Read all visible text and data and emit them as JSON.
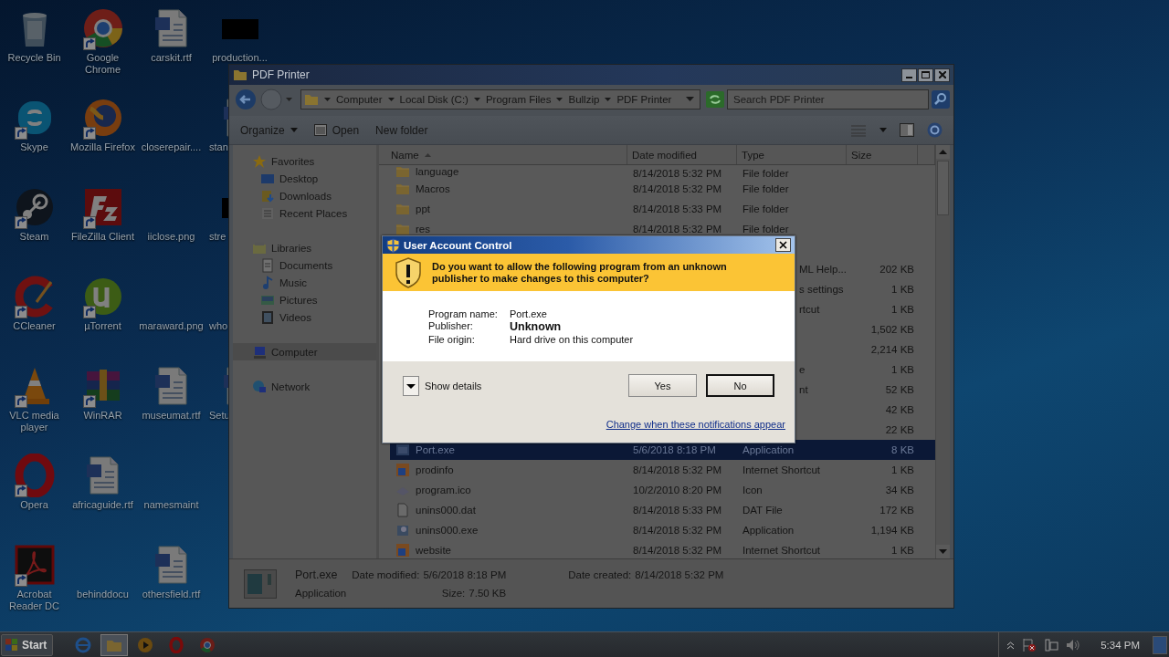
{
  "desktop": {
    "icons": [
      {
        "label": "Recycle Bin",
        "kind": "recycle",
        "shortcut": false
      },
      {
        "label": "Skype",
        "kind": "skype",
        "shortcut": true
      },
      {
        "label": "Steam",
        "kind": "steam",
        "shortcut": true
      },
      {
        "label": "CCleaner",
        "kind": "ccleaner",
        "shortcut": true
      },
      {
        "label": "VLC media player",
        "kind": "vlc",
        "shortcut": true
      },
      {
        "label": "Opera",
        "kind": "opera",
        "shortcut": true
      },
      {
        "label": "Acrobat Reader DC",
        "kind": "acrobat",
        "shortcut": true
      },
      {
        "label": "Google Chrome",
        "kind": "chrome",
        "shortcut": true
      },
      {
        "label": "Mozilla Firefox",
        "kind": "firefox",
        "shortcut": true
      },
      {
        "label": "FileZilla Client",
        "kind": "filezilla",
        "shortcut": true
      },
      {
        "label": "µTorrent",
        "kind": "utorrent",
        "shortcut": true
      },
      {
        "label": "WinRAR",
        "kind": "winrar",
        "shortcut": true
      },
      {
        "label": "africaguide.rtf",
        "kind": "document",
        "shortcut": false
      },
      {
        "label": "behinddocu",
        "kind": "blank",
        "shortcut": false
      },
      {
        "label": "carskit.rtf",
        "kind": "document",
        "shortcut": false
      },
      {
        "label": "closerepair....",
        "kind": "blank",
        "shortcut": false
      },
      {
        "label": "iiclose.png",
        "kind": "blank",
        "shortcut": false
      },
      {
        "label": "maraward.png",
        "kind": "blank",
        "shortcut": false
      },
      {
        "label": "museumat.rtf",
        "kind": "document",
        "shortcut": false
      },
      {
        "label": "namesmaint",
        "kind": "blank",
        "shortcut": false
      },
      {
        "label": "othersfield.rtf",
        "kind": "document",
        "shortcut": false
      },
      {
        "label": "production...",
        "kind": "dark",
        "shortcut": false
      },
      {
        "label": "stan",
        "kind": "document",
        "shortcut": false
      },
      {
        "label": "stre",
        "kind": "dark",
        "shortcut": false
      },
      {
        "label": "who",
        "kind": "blank",
        "shortcut": false
      },
      {
        "label": "Setu",
        "kind": "document",
        "shortcut": false
      }
    ]
  },
  "explorer": {
    "title": "PDF Printer",
    "breadcrumb": [
      "Computer",
      "Local Disk (C:)",
      "Program Files",
      "Bullzip",
      "PDF Printer"
    ],
    "search": {
      "placeholder": "Search PDF Printer"
    },
    "toolbar": [
      {
        "label": "Organize",
        "kind": "menu"
      },
      {
        "label": "Open",
        "kind": "open"
      },
      {
        "label": "New folder",
        "kind": "plain"
      }
    ],
    "nav": [
      {
        "label": "Favorites",
        "kind": "star",
        "selected": false,
        "children": [
          {
            "label": "Desktop",
            "kind": "desktop",
            "selected": false
          },
          {
            "label": "Downloads",
            "kind": "downloads",
            "selected": false
          },
          {
            "label": "Recent Places",
            "kind": "recent",
            "selected": false
          }
        ]
      },
      {
        "label": "Libraries",
        "kind": "libraries",
        "selected": false,
        "children": [
          {
            "label": "Documents",
            "kind": "documents",
            "selected": false
          },
          {
            "label": "Music",
            "kind": "music",
            "selected": false
          },
          {
            "label": "Pictures",
            "kind": "pictures",
            "selected": false
          },
          {
            "label": "Videos",
            "kind": "videos",
            "selected": false
          }
        ]
      },
      {
        "label": "Computer",
        "kind": "computer",
        "selected": true
      },
      {
        "label": "Network",
        "kind": "network",
        "selected": false
      }
    ],
    "columns": [
      "Name",
      "Date modified",
      "Type",
      "Size"
    ],
    "rows": [
      {
        "name": "language",
        "date": "8/14/2018 5:32 PM",
        "type": "File folder",
        "kind": "folder",
        "selected": false
      },
      {
        "name": "Macros",
        "date": "8/14/2018 5:32 PM",
        "type": "File folder",
        "kind": "folder",
        "selected": false
      },
      {
        "name": "ppt",
        "date": "8/14/2018 5:33 PM",
        "type": "File folder",
        "kind": "folder",
        "selected": false
      },
      {
        "name": "res",
        "date": "8/14/2018 5:32 PM",
        "type": "File folder",
        "kind": "folder",
        "selected": false
      },
      {
        "type": "ML Help...",
        "size": "202 KB",
        "selected": false
      },
      {
        "type": "s settings",
        "size": "1 KB",
        "selected": false
      },
      {
        "type": "rtcut",
        "size": "1 KB",
        "selected": false
      },
      {
        "size": "1,502 KB",
        "selected": false
      },
      {
        "size": "2,214 KB",
        "selected": false
      },
      {
        "type": "e",
        "size": "1 KB",
        "selected": false
      },
      {
        "type": "nt",
        "size": "52 KB",
        "selected": false
      },
      {
        "size": "42 KB",
        "selected": false
      },
      {
        "size": "22 KB",
        "selected": false
      },
      {
        "name": "Port.exe",
        "date": "5/6/2018 8:18 PM",
        "type": "Application",
        "size": "8 KB",
        "kind": "app",
        "selected": true
      },
      {
        "name": "prodinfo",
        "date": "8/14/2018 5:32 PM",
        "type": "Internet Shortcut",
        "size": "1 KB",
        "kind": "link",
        "selected": false
      },
      {
        "name": "program.ico",
        "date": "10/2/2010 8:20 PM",
        "type": "Icon",
        "size": "34 KB",
        "kind": "ico",
        "selected": false
      },
      {
        "name": "unins000.dat",
        "date": "8/14/2018 5:33 PM",
        "type": "DAT File",
        "size": "172 KB",
        "kind": "file",
        "selected": false
      },
      {
        "name": "unins000.exe",
        "date": "8/14/2018 5:32 PM",
        "type": "Application",
        "size": "1,194 KB",
        "kind": "setup",
        "selected": false
      },
      {
        "name": "website",
        "date": "8/14/2018 5:32 PM",
        "type": "Internet Shortcut",
        "size": "1 KB",
        "kind": "link",
        "selected": false
      }
    ],
    "details": {
      "name": "Port.exe",
      "type": "Application",
      "fields": [
        {
          "label": "Date modified:",
          "value": "5/6/2018 8:18 PM"
        },
        {
          "label": "Date created:",
          "value": "8/14/2018 5:32 PM"
        },
        {
          "label": "Size:",
          "value": "7.50 KB"
        }
      ]
    }
  },
  "uac": {
    "title": "User Account Control",
    "question": "Do you want to allow the following program from an unknown publisher to make changes to this computer?",
    "fields": [
      {
        "label": "Program name:",
        "value": "Port.exe",
        "bold": false
      },
      {
        "label": "Publisher:",
        "value": "Unknown",
        "bold": true
      },
      {
        "label": "File origin:",
        "value": "Hard drive on this computer",
        "bold": false
      }
    ],
    "details_toggle": "Show details",
    "buttons": [
      {
        "label": "Yes",
        "default": false
      },
      {
        "label": "No",
        "default": true
      }
    ],
    "link": "Change when these notifications appear"
  },
  "taskbar": {
    "start": "Start",
    "apps": [
      {
        "kind": "ie",
        "selected": false
      },
      {
        "kind": "explorer",
        "selected": true
      },
      {
        "kind": "media",
        "selected": false
      },
      {
        "kind": "opera",
        "selected": false
      },
      {
        "kind": "chrome",
        "selected": false
      }
    ],
    "clock": "5:34 PM"
  }
}
